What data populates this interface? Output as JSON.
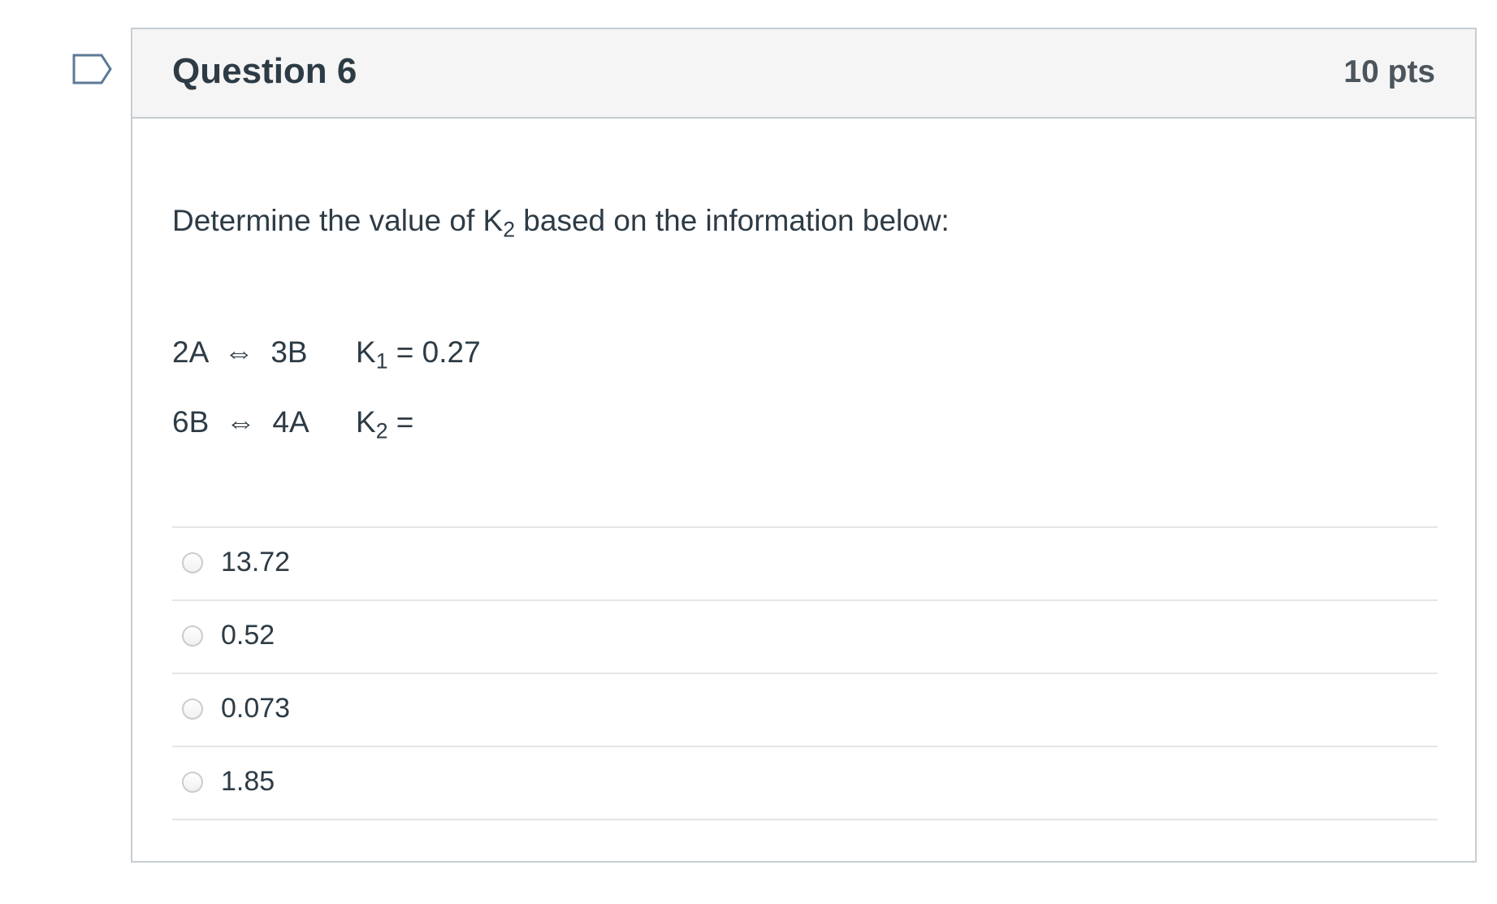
{
  "question": {
    "name": "Question 6",
    "points": "10 pts"
  },
  "prompt": {
    "before": "Determine the value of K",
    "sub": "2",
    "after": " based on the information below:"
  },
  "equations": [
    {
      "reaction": "2A  ⇔  3B",
      "k_label": "K",
      "k_sub": "1",
      "k_rest": " = 0.27"
    },
    {
      "reaction": "6B  ⇔  4A",
      "k_label": "K",
      "k_sub": "2",
      "k_rest": " ="
    }
  ],
  "answers": [
    {
      "label": "13.72",
      "selected": false
    },
    {
      "label": "0.52",
      "selected": false
    },
    {
      "label": "0.073",
      "selected": false
    },
    {
      "label": "1.85",
      "selected": false
    }
  ],
  "icons": {
    "flag": "flag-question-icon"
  },
  "colors": {
    "border": "#c7cdd1",
    "header_bg": "#f5f5f5",
    "text": "#2d3b45",
    "flag_stroke": "#5b7a96"
  }
}
